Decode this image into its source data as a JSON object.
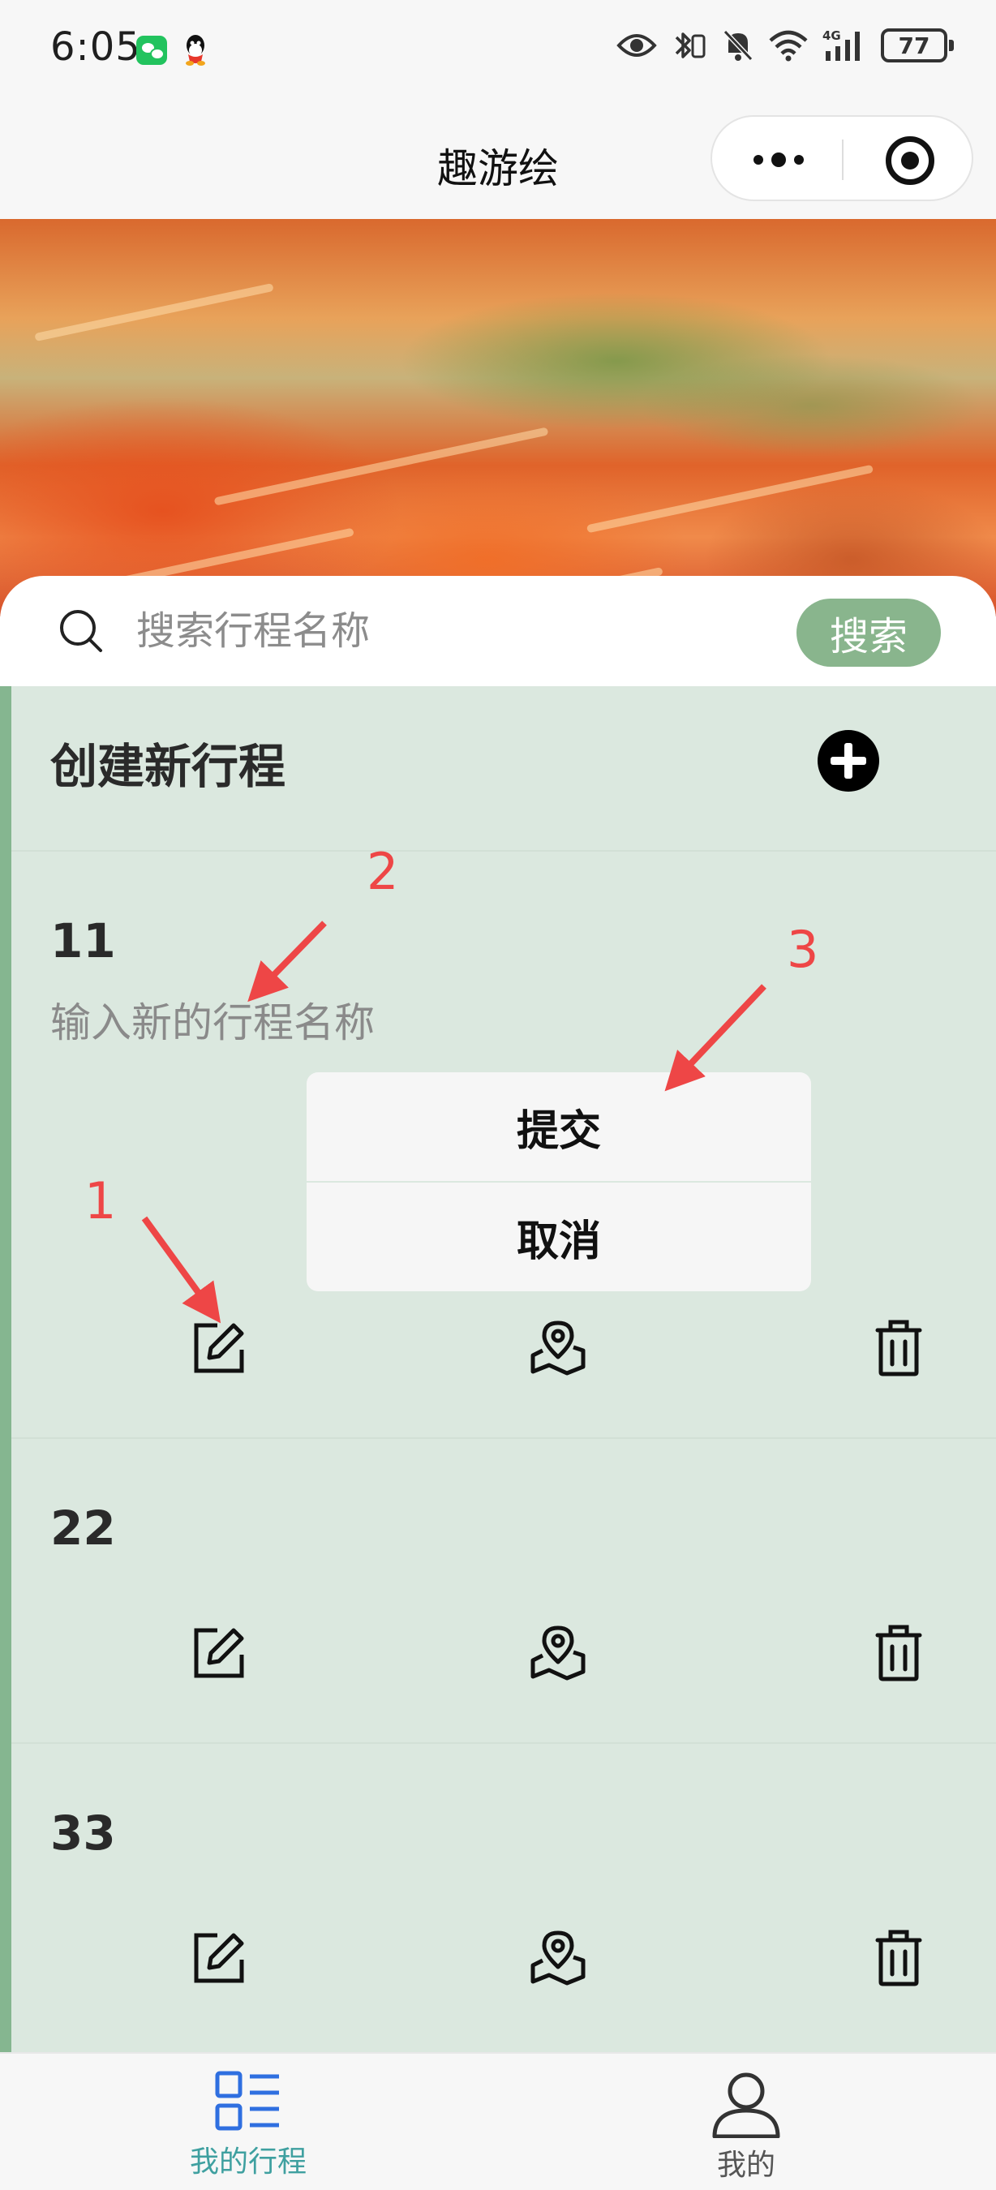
{
  "status_bar": {
    "time": "6:05",
    "battery": "77",
    "icons": [
      "wechat-icon",
      "qq-icon",
      "eye-icon",
      "bluetooth-icon",
      "mute-icon",
      "wifi-icon",
      "4g-signal-icon",
      "battery-icon"
    ]
  },
  "nav": {
    "title": "趣游绘",
    "more_icon": "more-dots-icon",
    "close_icon": "miniprogram-close-icon"
  },
  "search": {
    "placeholder": "搜索行程名称",
    "button_label": "搜索"
  },
  "create": {
    "label": "创建新行程",
    "icon": "plus-circle-icon"
  },
  "trips": [
    {
      "name": "11",
      "editing": true,
      "rename_placeholder": "输入新的行程名称",
      "submit_label": "提交",
      "cancel_label": "取消"
    },
    {
      "name": "22"
    },
    {
      "name": "33"
    }
  ],
  "trip_action_icons": [
    "edit-icon",
    "map-location-icon",
    "trash-icon"
  ],
  "annotations": [
    "1",
    "2",
    "3"
  ],
  "colors": {
    "accent_green": "#89b58d",
    "content_bg": "#dbe8df",
    "stripe": "#85b690",
    "annotation_red": "#ee4646",
    "tab_active_blue": "#2f6fe0",
    "tab_active_label": "#3fa0a0"
  },
  "tabbar": {
    "items": [
      {
        "label": "我的行程",
        "icon": "list-grid-icon",
        "active": true
      },
      {
        "label": "我的",
        "icon": "person-icon",
        "active": false
      }
    ]
  }
}
